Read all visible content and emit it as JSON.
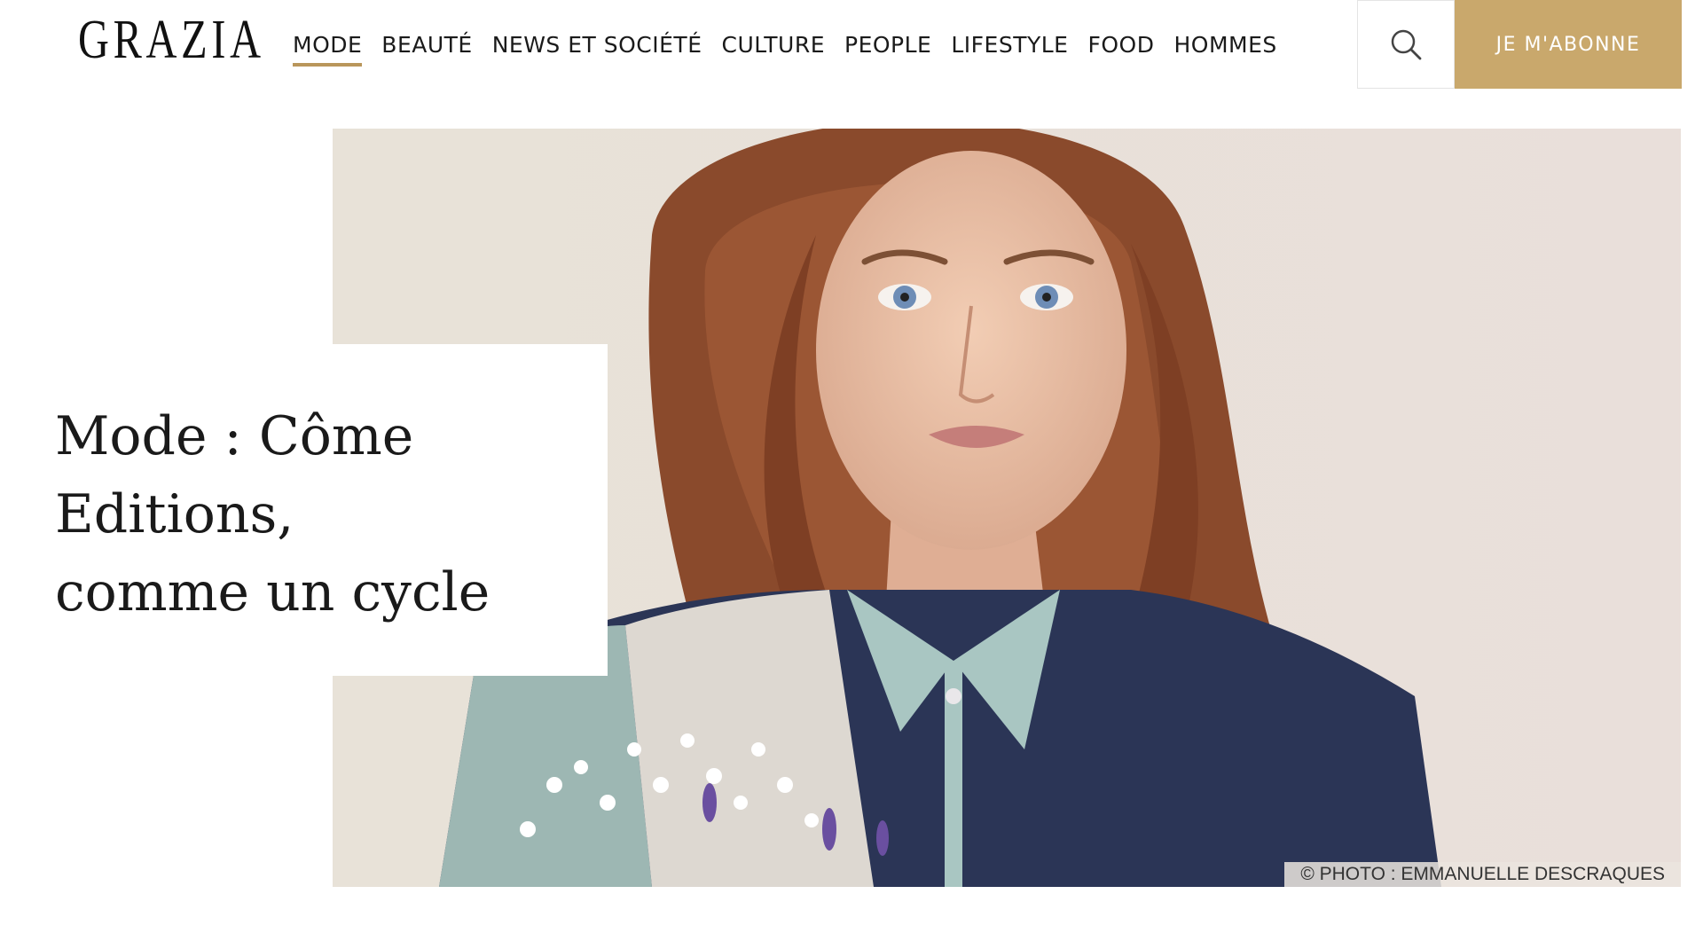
{
  "header": {
    "logo": "GRAZIA",
    "nav": [
      {
        "label": "MODE",
        "active": true
      },
      {
        "label": "BEAUTÉ",
        "active": false
      },
      {
        "label": "NEWS ET SOCIÉTÉ",
        "active": false
      },
      {
        "label": "CULTURE",
        "active": false
      },
      {
        "label": "PEOPLE",
        "active": false
      },
      {
        "label": "LIFESTYLE",
        "active": false
      },
      {
        "label": "FOOD",
        "active": false
      },
      {
        "label": "HOMMES",
        "active": false
      }
    ],
    "search_icon": "search-icon",
    "subscribe_label": "JE M'ABONNE"
  },
  "article": {
    "title": "Mode : Côme\nEditions,\ncomme un cycle",
    "photo_credit": "© PHOTO : EMMANUELLE DESCRAQUES"
  },
  "colors": {
    "accent": "#c9a86c",
    "underline": "#b9965b",
    "text": "#1a1a1a"
  }
}
